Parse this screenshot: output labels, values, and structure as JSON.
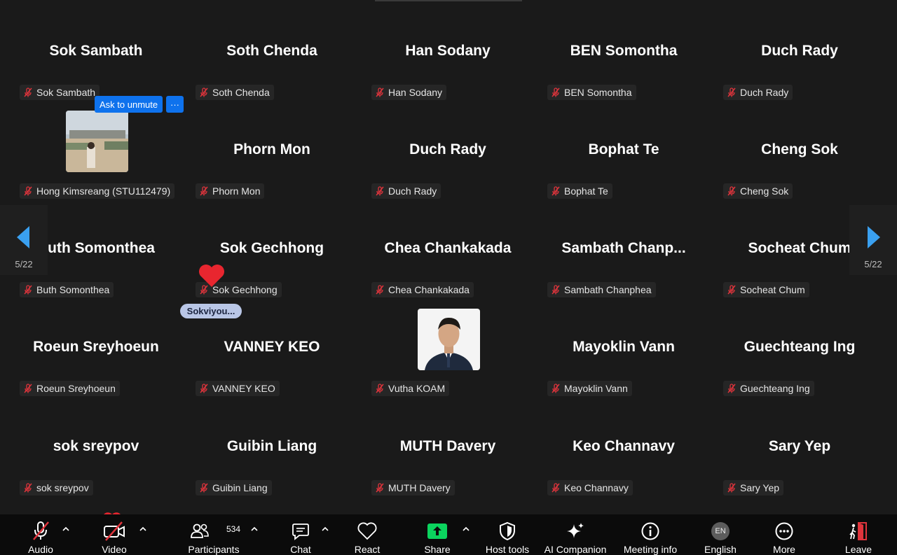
{
  "gallery": {
    "tiles": [
      {
        "name": "Sok Sambath",
        "label": "Sok Sambath"
      },
      {
        "name": "Soth Chenda",
        "label": "Soth Chenda"
      },
      {
        "name": "Han Sodany",
        "label": "Han Sodany"
      },
      {
        "name": "BEN Somontha",
        "label": "BEN Somontha"
      },
      {
        "name": "Duch Rady",
        "label": "Duch Rady"
      },
      {
        "name": "",
        "label": "Hong Kimsreang (STU112479)"
      },
      {
        "name": "Phorn Mon",
        "label": "Phorn Mon"
      },
      {
        "name": "Duch Rady",
        "label": "Duch Rady"
      },
      {
        "name": "Bophat Te",
        "label": "Bophat Te"
      },
      {
        "name": "Cheng Sok",
        "label": "Cheng Sok"
      },
      {
        "name": "Buth Somonthea",
        "label": "Buth Somonthea"
      },
      {
        "name": "Sok Gechhong",
        "label": "Sok Gechhong"
      },
      {
        "name": "Chea Chankakada",
        "label": "Chea Chankakada"
      },
      {
        "name": "Sambath  Chanp...",
        "label": "Sambath Chanphea"
      },
      {
        "name": "Socheat Chum",
        "label": "Socheat Chum"
      },
      {
        "name": "Roeun Sreyhoeun",
        "label": "Roeun Sreyhoeun"
      },
      {
        "name": "VANNEY KEO",
        "label": "VANNEY KEO"
      },
      {
        "name": "",
        "label": "Vutha KOAM"
      },
      {
        "name": "Mayoklin Vann",
        "label": "Mayoklin Vann"
      },
      {
        "name": "Guechteang Ing",
        "label": "Guechteang Ing"
      },
      {
        "name": "sok sreypov",
        "label": "sok sreypov"
      },
      {
        "name": "Guibin Liang",
        "label": "Guibin Liang"
      },
      {
        "name": "MUTH Davery",
        "label": "MUTH Davery"
      },
      {
        "name": "Keo Channavy",
        "label": "Keo Channavy"
      },
      {
        "name": "Sary Yep",
        "label": "Sary Yep"
      }
    ]
  },
  "hover_menu": {
    "ask_to_unmute": "Ask to unmute",
    "more": "···"
  },
  "pagination": {
    "left_page": "5/22",
    "right_page": "5/22"
  },
  "reaction": {
    "pill_text": "Sokviyou..."
  },
  "toolbar": {
    "audio": "Audio",
    "video": "Video",
    "participants": "Participants",
    "participants_count": "534",
    "chat": "Chat",
    "react": "React",
    "share": "Share",
    "host_tools": "Host tools",
    "ai_companion": "AI Companion",
    "meeting_info": "Meeting info",
    "language": "English",
    "language_badge": "EN",
    "more": "More",
    "leave": "Leave"
  },
  "colors": {
    "accent_blue": "#0e72ed",
    "share_green": "#0bd45e",
    "muted_red": "#e0343c",
    "leave_red": "#e0343c",
    "background": "#1a1a1a"
  }
}
